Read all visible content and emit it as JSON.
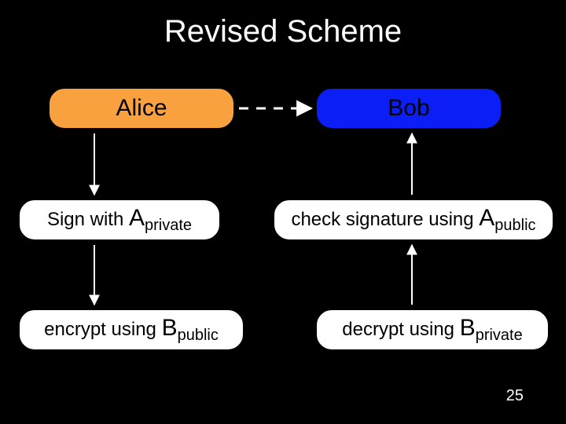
{
  "title": "Revised Scheme",
  "alice": {
    "label": "Alice"
  },
  "bob": {
    "label": "Bob"
  },
  "left": {
    "sign": {
      "prefix": "Sign with ",
      "key": "A",
      "sub": "private"
    },
    "encrypt": {
      "prefix": "encrypt using ",
      "key": "B",
      "sub": "public"
    }
  },
  "right": {
    "check": {
      "prefix": "check signature using ",
      "key": "A",
      "sub": "public"
    },
    "decrypt": {
      "prefix": "decrypt using ",
      "key": "B",
      "sub": "private"
    }
  },
  "page": "25"
}
